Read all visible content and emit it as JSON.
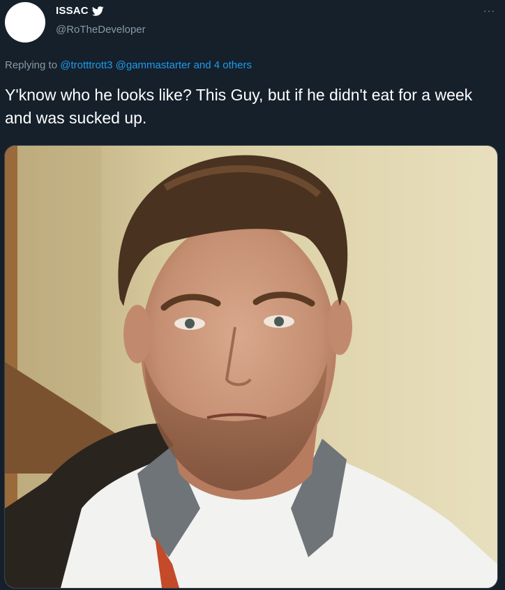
{
  "author": {
    "display_name": "ISSAC",
    "handle": "@RoTheDeveloper"
  },
  "menu": {
    "more_label": "···"
  },
  "reply": {
    "prefix": "Replying to",
    "mention_1": "@trotttrott3",
    "mention_2": "@gammastarter",
    "connector": "and",
    "others": "4 others"
  },
  "tweet": {
    "text": "Y'know who he looks like? This Guy, but if he didn't eat for a week and was sucked up."
  },
  "icons": {
    "bird": "twitter-bird-icon",
    "more": "more-dots-icon"
  },
  "colors": {
    "background": "#15202b",
    "secondary_text": "#8899a6",
    "link": "#1d9bf0",
    "border": "#38444d"
  }
}
